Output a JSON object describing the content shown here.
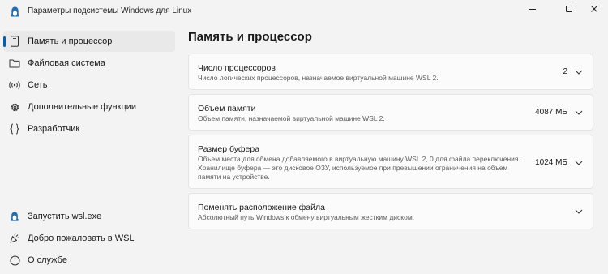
{
  "window": {
    "title": "Параметры подсистемы Windows для Linux",
    "controls": [
      "minimize",
      "maximize",
      "close"
    ]
  },
  "sidebar": {
    "items": [
      {
        "label": "Память и процессор",
        "icon": "memory-icon",
        "active": true
      },
      {
        "label": "Файловая система",
        "icon": "folder-icon",
        "active": false
      },
      {
        "label": "Сеть",
        "icon": "network-icon",
        "active": false
      },
      {
        "label": "Дополнительные функции",
        "icon": "gear-icon",
        "active": false
      },
      {
        "label": "Разработчик",
        "icon": "braces-icon",
        "active": false
      }
    ],
    "footer_items": [
      {
        "label": "Запустить wsl.exe",
        "icon": "penguin-icon"
      },
      {
        "label": "Добро пожаловать в WSL",
        "icon": "welcome-icon"
      },
      {
        "label": "О службе",
        "icon": "info-icon"
      }
    ]
  },
  "main": {
    "title": "Память и процессор",
    "settings": [
      {
        "title": "Число процессоров",
        "description": "Число логических процессоров, назначаемое виртуальной машине WSL 2.",
        "value": "2"
      },
      {
        "title": "Объем памяти",
        "description": "Объем памяти, назначаемой виртуальной машине WSL 2.",
        "value": "4087 МБ"
      },
      {
        "title": "Размер буфера",
        "description": "Объем места для обмена добавляемого в виртуальную машину WSL 2, 0 для файла переключения. Хранилище буфера — это дисковое ОЗУ, используемое при превышении ограничения на объем памяти на устройстве.",
        "value": "1024 МБ"
      },
      {
        "title": "Поменять расположение файла",
        "description": "Абсолютный путь Windows к обмену виртуальным жестким диском.",
        "value": ""
      }
    ]
  },
  "colors": {
    "accent": "#005fb8",
    "background": "#f3f3f3",
    "card": "#fbfbfb"
  }
}
